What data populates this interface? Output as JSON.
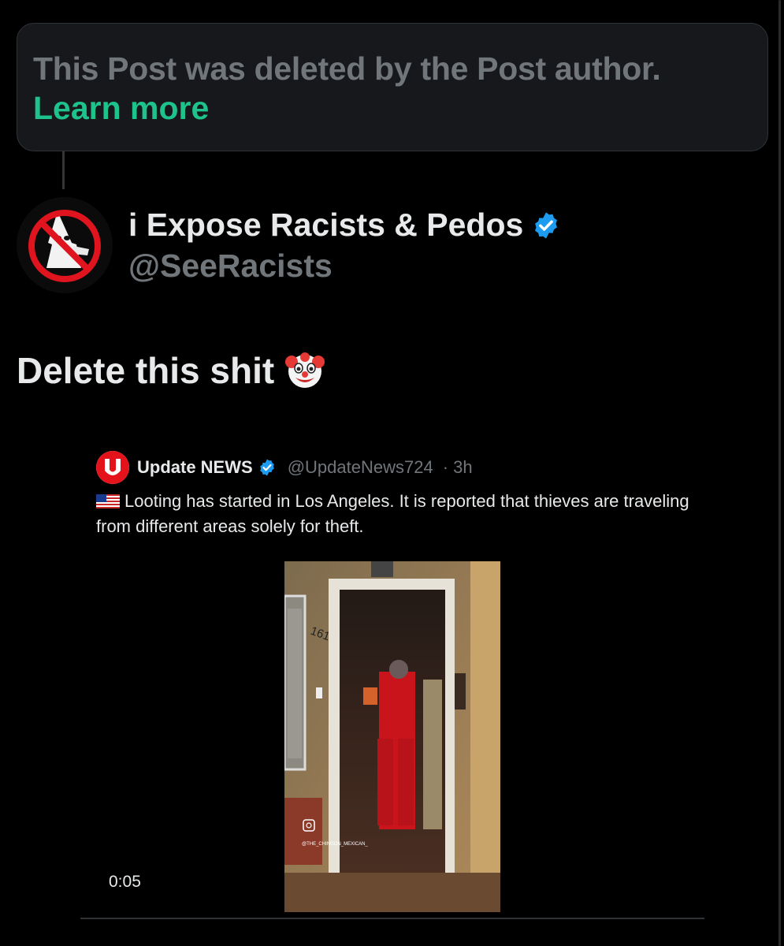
{
  "deleted_notice": {
    "text": "This Post was deleted by the Post author.",
    "link": "Learn more",
    "link_color": "#1ec28b"
  },
  "author": {
    "name": "i Expose Racists & Pedos",
    "handle": "@SeeRacists",
    "verified": true,
    "avatar_icon": "no-klan-icon"
  },
  "post": {
    "text": "Delete this shit",
    "emoji": "clown-face-icon"
  },
  "quoted_post": {
    "logo_icon": "update-news-logo",
    "name": "Update NEWS",
    "handle": "@UpdateNews724",
    "time": "· 3h",
    "flag_icon": "us-flag-icon",
    "text": "Looting has started in Los Angeles. It is reported that thieves are traveling from different areas solely for theft.",
    "video": {
      "duration": "0:05",
      "house_number": "161",
      "watermark": "@THE_CHINGON_MEXICAN_"
    }
  },
  "colors": {
    "background": "#000000",
    "verified_blue": "#1d9bf0",
    "muted_text": "#71767b"
  }
}
